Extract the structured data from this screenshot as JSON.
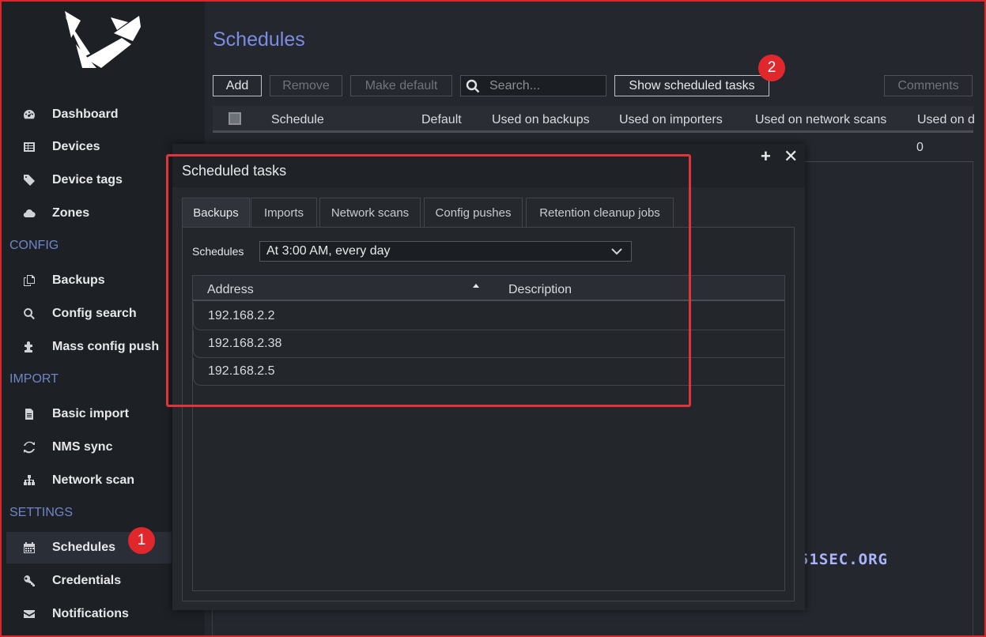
{
  "sidebar": {
    "items": [
      {
        "label": "Dashboard",
        "icon": "dashboard-icon"
      },
      {
        "label": "Devices",
        "icon": "table-icon"
      },
      {
        "label": "Device tags",
        "icon": "tags-icon"
      },
      {
        "label": "Zones",
        "icon": "cloud-icon"
      },
      {
        "label": "Backups",
        "icon": "copy-icon"
      },
      {
        "label": "Config search",
        "icon": "search-icon"
      },
      {
        "label": "Mass config push",
        "icon": "puzzle-icon"
      },
      {
        "label": "Basic import",
        "icon": "file-icon"
      },
      {
        "label": "NMS sync",
        "icon": "refresh-icon"
      },
      {
        "label": "Network scan",
        "icon": "sitemap-icon"
      },
      {
        "label": "Schedules",
        "icon": "calendar-icon"
      },
      {
        "label": "Credentials",
        "icon": "key-icon"
      },
      {
        "label": "Notifications",
        "icon": "envelope-icon"
      }
    ],
    "sections": [
      "CONFIG",
      "IMPORT",
      "SETTINGS"
    ],
    "active": "Schedules"
  },
  "annotations": {
    "badge1": "1",
    "badge2": "2"
  },
  "main": {
    "title": "Schedules",
    "toolbar": {
      "add": "Add",
      "remove": "Remove",
      "make_default": "Make default",
      "search_placeholder": "Search...",
      "show_scheduled": "Show scheduled tasks",
      "comments": "Comments"
    },
    "columns": [
      "Schedule",
      "Default",
      "Used on backups",
      "Used on importers",
      "Used on network scans",
      "Used on d"
    ],
    "row_value": "0"
  },
  "dialog": {
    "title": "Scheduled tasks",
    "tabs": [
      "Backups",
      "Imports",
      "Network scans",
      "Config pushes",
      "Retention cleanup jobs"
    ],
    "active_tab": "Backups",
    "schedules_label": "Schedules",
    "schedule_selected": "At 3:00 AM, every day",
    "columns": [
      "Address",
      "Description"
    ],
    "rows": [
      "192.168.2.2",
      "192.168.2.38",
      "192.168.2.5"
    ]
  },
  "watermark": "51SEC.ORG",
  "colors": {
    "accent": "#7b8de2",
    "badge": "#e0282c",
    "highlight": "#e0343a",
    "section": "#6f86c9"
  }
}
